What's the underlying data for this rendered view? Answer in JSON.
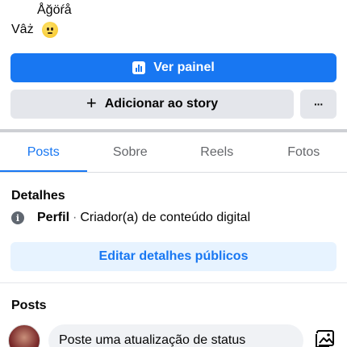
{
  "profile": {
    "name_line1": "Åğöŕå",
    "name_line2": "Vâż"
  },
  "actions": {
    "dashboard_label": "Ver painel",
    "add_story_label": "Adicionar ao story",
    "more_label": "···"
  },
  "tabs": [
    {
      "label": "Posts",
      "active": true
    },
    {
      "label": "Sobre",
      "active": false
    },
    {
      "label": "Reels",
      "active": false
    },
    {
      "label": "Fotos",
      "active": false
    }
  ],
  "details": {
    "title": "Detalhes",
    "profile_label": "Perfil",
    "separator": "·",
    "category": "Criador(a) de conteúdo digital",
    "edit_label": "Editar detalhes públicos"
  },
  "posts": {
    "title": "Posts",
    "status_placeholder": "Poste uma atualização de status"
  },
  "colors": {
    "accent": "#1877f2",
    "secondary_bg": "#e4e6eb",
    "edit_bg": "#e7f3ff"
  }
}
